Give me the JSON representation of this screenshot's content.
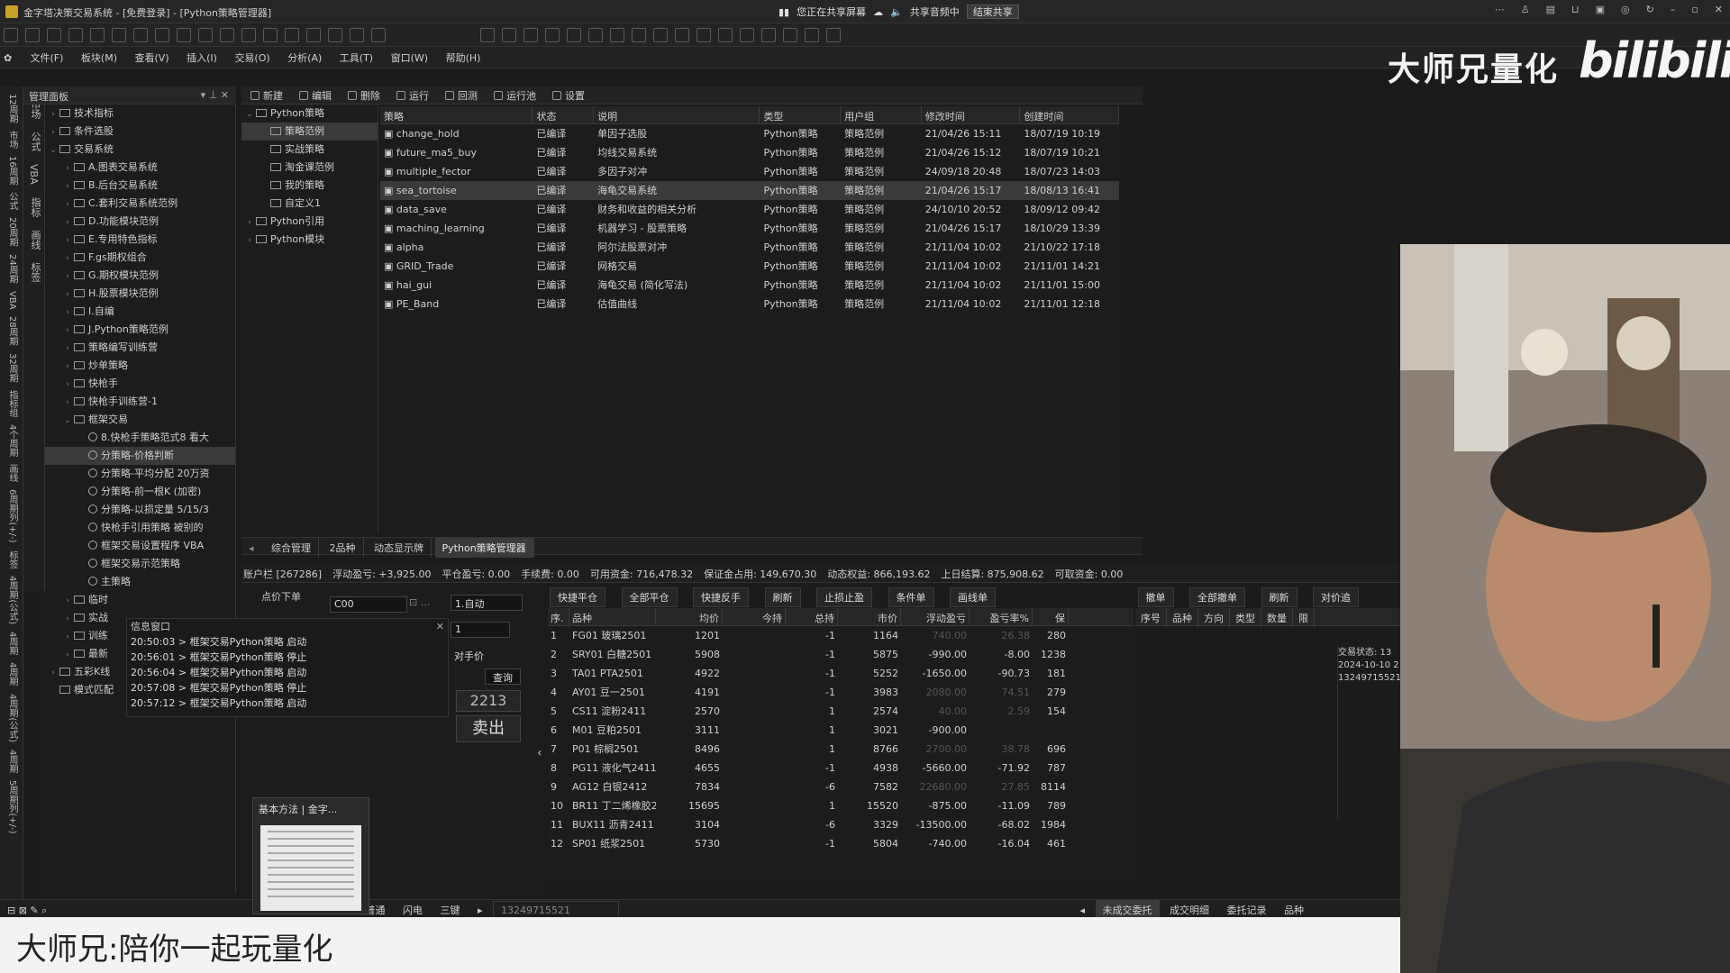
{
  "window": {
    "title": "金字塔决策交易系统 - [免费登录] - [Python策略管理器]",
    "share_status": "您正在共享屏幕",
    "share_audio": "共享音频中",
    "end_share": "结束共享"
  },
  "menu": [
    "文件(F)",
    "板块(M)",
    "查看(V)",
    "插入(I)",
    "交易(O)",
    "分析(A)",
    "工具(T)",
    "窗口(W)",
    "帮助(H)"
  ],
  "brand": {
    "name": "大师兄量化",
    "logo": "bilibili"
  },
  "left_tabs": [
    "12周期",
    "市场",
    "16周期",
    "公式",
    "20周期",
    "24周期",
    "VBA",
    "28周期",
    "32周期",
    "指标组",
    "4个周期",
    "画线",
    "6周期列(+/-)",
    "标签",
    "4周期(公式)",
    "4周期",
    "4周期",
    "4周期(公式)",
    "4周期",
    "5周期列(+/-)"
  ],
  "left_tabs2": [
    "市场",
    "公式",
    "VBA",
    "指标",
    "画线",
    "标签"
  ],
  "panel": {
    "title": "管理面板"
  },
  "tree1": [
    {
      "label": "技术指标",
      "exp": "›",
      "lvl": 0
    },
    {
      "label": "条件选股",
      "exp": "›",
      "lvl": 0
    },
    {
      "label": "交易系统",
      "exp": "⌄",
      "lvl": 0
    },
    {
      "label": "A.图表交易系统",
      "exp": "›",
      "lvl": 1
    },
    {
      "label": "B.后台交易系统",
      "exp": "›",
      "lvl": 1
    },
    {
      "label": "C.套利交易系统范例",
      "exp": "›",
      "lvl": 1
    },
    {
      "label": "D.功能模块范例",
      "exp": "›",
      "lvl": 1
    },
    {
      "label": "E.专用特色指标",
      "exp": "›",
      "lvl": 1
    },
    {
      "label": "F.gs期权组合",
      "exp": "›",
      "lvl": 1
    },
    {
      "label": "G.期权模块范例",
      "exp": "›",
      "lvl": 1
    },
    {
      "label": "H.股票模块范例",
      "exp": "›",
      "lvl": 1
    },
    {
      "label": "I.自编",
      "exp": "›",
      "lvl": 1
    },
    {
      "label": "J.Python策略范例",
      "exp": "›",
      "lvl": 1
    },
    {
      "label": "策略编写训练营",
      "exp": "›",
      "lvl": 1
    },
    {
      "label": "炒单策略",
      "exp": "›",
      "lvl": 1
    },
    {
      "label": "快枪手",
      "exp": "›",
      "lvl": 1
    },
    {
      "label": "快枪手训练营-1",
      "exp": "›",
      "lvl": 1
    },
    {
      "label": "框架交易",
      "exp": "⌄",
      "lvl": 1
    },
    {
      "label": "8.快枪手策略范式8 看大",
      "exp": "",
      "lvl": 2,
      "gear": true
    },
    {
      "label": "分策略-价格判断",
      "exp": "",
      "lvl": 2,
      "gear": true,
      "sel": true
    },
    {
      "label": "分策略-平均分配 20万资",
      "exp": "",
      "lvl": 2,
      "gear": true
    },
    {
      "label": "分策略-前一根K (加密)",
      "exp": "",
      "lvl": 2,
      "gear": true
    },
    {
      "label": "分策略-以损定量 5/15/3",
      "exp": "",
      "lvl": 2,
      "gear": true
    },
    {
      "label": "快枪手引用策略 被别的",
      "exp": "",
      "lvl": 2,
      "gear": true
    },
    {
      "label": "框架交易设置程序 VBA",
      "exp": "",
      "lvl": 2,
      "gear": true
    },
    {
      "label": "框架交易示范策略",
      "exp": "",
      "lvl": 2,
      "gear": true
    },
    {
      "label": "主策略",
      "exp": "",
      "lvl": 2,
      "gear": true
    },
    {
      "label": "临时",
      "exp": "›",
      "lvl": 1
    },
    {
      "label": "实战",
      "exp": "›",
      "lvl": 1
    },
    {
      "label": "训练",
      "exp": "›",
      "lvl": 1
    },
    {
      "label": "最新",
      "exp": "›",
      "lvl": 1
    },
    {
      "label": "五彩K线",
      "exp": "›",
      "lvl": 0
    },
    {
      "label": "模式匹配",
      "exp": "",
      "lvl": 0
    }
  ],
  "toolbar2": [
    "新建",
    "编辑",
    "删除",
    "运行",
    "回测",
    "运行池",
    "设置"
  ],
  "tree2": [
    {
      "label": "Python策略",
      "exp": "⌄",
      "lvl": 0
    },
    {
      "label": "策略范例",
      "exp": "",
      "lvl": 1,
      "sel": true
    },
    {
      "label": "实战策略",
      "exp": "",
      "lvl": 1
    },
    {
      "label": "淘金课范例",
      "exp": "",
      "lvl": 1
    },
    {
      "label": "我的策略",
      "exp": "",
      "lvl": 1
    },
    {
      "label": "自定义1",
      "exp": "",
      "lvl": 1
    },
    {
      "label": "Python引用",
      "exp": "›",
      "lvl": 0
    },
    {
      "label": "Python模块",
      "exp": "›",
      "lvl": 0
    }
  ],
  "strategy_table": {
    "headers": [
      "策略",
      "状态",
      "说明",
      "类型",
      "用户组",
      "修改时间",
      "创建时间"
    ],
    "rows": [
      [
        "change_hold",
        "已编译",
        "单因子选股",
        "Python策略",
        "策略范例",
        "21/04/26 15:11",
        "18/07/19 10:19"
      ],
      [
        "future_ma5_buy",
        "已编译",
        "均线交易系统",
        "Python策略",
        "策略范例",
        "21/04/26 15:12",
        "18/07/19 10:21"
      ],
      [
        "multiple_fector",
        "已编译",
        "多因子对冲",
        "Python策略",
        "策略范例",
        "24/09/18 20:48",
        "18/07/23 14:03"
      ],
      [
        "sea_tortoise",
        "已编译",
        "海龟交易系统",
        "Python策略",
        "策略范例",
        "21/04/26 15:17",
        "18/08/13 16:41"
      ],
      [
        "data_save",
        "已编译",
        "财务和收益的相关分析",
        "Python策略",
        "策略范例",
        "24/10/10 20:52",
        "18/09/12 09:42"
      ],
      [
        "maching_learning",
        "已编译",
        "机器学习 - 股票策略",
        "Python策略",
        "策略范例",
        "21/04/26 15:17",
        "18/10/29 13:39"
      ],
      [
        "alpha",
        "已编译",
        "阿尔法股票对冲",
        "Python策略",
        "策略范例",
        "21/11/04 10:02",
        "21/10/22 17:18"
      ],
      [
        "GRID_Trade",
        "已编译",
        "网格交易",
        "Python策略",
        "策略范例",
        "21/11/04 10:02",
        "21/11/01 14:21"
      ],
      [
        "hai_gui",
        "已编译",
        "海龟交易 (简化写法)",
        "Python策略",
        "策略范例",
        "21/11/04 10:02",
        "21/11/01 15:00"
      ],
      [
        "PE_Band",
        "已编译",
        "估值曲线",
        "Python策略",
        "策略范例",
        "21/11/04 10:02",
        "21/11/01 12:18"
      ]
    ]
  },
  "mid_tabs": [
    "综合管理",
    "2品种",
    "动态显示牌",
    "Python策略管理器"
  ],
  "account": [
    "账户栏 [267286]",
    "浮动盈亏: +3,925.00",
    "平仓盈亏: 0.00",
    "手续费: 0.00",
    "可用资金: 716,478.32",
    "保证金占用: 149,670.30",
    "动态权益: 866,193.62",
    "上日结算: 875,908.62",
    "可取资金: 0.00"
  ],
  "order": {
    "label": "点价下单",
    "code": "C00",
    "mode": "1.自动",
    "qty": "1",
    "price_type": "对手价",
    "query": "查询",
    "price": "2213",
    "sell": "卖出"
  },
  "log": {
    "title": "信息窗口",
    "lines": [
      "20:50:03 > 框架交易Python策略 启动",
      "20:56:01 > 框架交易Python策略 停止",
      "20:56:04 > 框架交易Python策略 启动",
      "20:57:08 > 框架交易Python策略 停止",
      "20:57:12 > 框架交易Python策略 启动"
    ]
  },
  "pos_buttons": [
    "快捷平仓",
    "全部平仓",
    "快捷反手",
    "刷新",
    "止损止盈",
    "条件单",
    "画线单"
  ],
  "right_buttons": [
    "撤单",
    "全部撤单",
    "刷新",
    "对价追"
  ],
  "pos_table": {
    "headers": [
      "序.",
      "品种",
      "均价",
      "今持",
      "总持",
      "市价",
      "浮动盈亏",
      "盈亏率%",
      "保"
    ],
    "rows": [
      [
        "1",
        "FG01 玻璃2501",
        "1201",
        "",
        "-1",
        "1164",
        "740.00",
        "26.38",
        "280"
      ],
      [
        "2",
        "SRY01 白糖2501",
        "5908",
        "",
        "-1",
        "5875",
        "-990.00",
        "-8.00",
        "1238"
      ],
      [
        "3",
        "TA01 PTA2501",
        "4922",
        "",
        "-1",
        "5252",
        "-1650.00",
        "-90.73",
        "181"
      ],
      [
        "4",
        "AY01 豆一2501",
        "4191",
        "",
        "-1",
        "3983",
        "2080.00",
        "74.51",
        "279"
      ],
      [
        "5",
        "CS11 淀粉2411",
        "2570",
        "",
        "1",
        "2574",
        "40.00",
        "2.59",
        "154"
      ],
      [
        "6",
        "M01 豆粕2501",
        "3111",
        "",
        "1",
        "3021",
        "-900.00",
        "",
        ""
      ],
      [
        "7",
        "P01 棕榈2501",
        "8496",
        "",
        "1",
        "8766",
        "2700.00",
        "38.78",
        "696"
      ],
      [
        "8",
        "PG11 液化气2411",
        "4655",
        "",
        "-1",
        "4938",
        "-5660.00",
        "-71.92",
        "787"
      ],
      [
        "9",
        "AG12 白银2412",
        "7834",
        "",
        "-6",
        "7582",
        "22680.00",
        "27.85",
        "8114"
      ],
      [
        "10",
        "BR11 丁二烯橡胶2411",
        "15695",
        "",
        "1",
        "15520",
        "-875.00",
        "-11.09",
        "789"
      ],
      [
        "11",
        "BUX11 沥青2411",
        "3104",
        "",
        "-6",
        "3329",
        "-13500.00",
        "-68.02",
        "1984"
      ],
      [
        "12",
        "SP01 纸浆2501",
        "5730",
        "",
        "-1",
        "5804",
        "-740.00",
        "-16.04",
        "461"
      ]
    ]
  },
  "order_table_headers": [
    "序号",
    "品种",
    "方向",
    "类型",
    "数量",
    "限"
  ],
  "status": {
    "label": "交易状态: 13",
    "date": "2024-10-10 2",
    "acct": "13249715521"
  },
  "bottom": {
    "tabs": [
      "普通",
      "闪电",
      "三键"
    ],
    "account_no": "13249715521",
    "right_tabs": [
      "未成交委托",
      "成交明细",
      "委托记录",
      "品种"
    ]
  },
  "thumb": {
    "title": "基本方法 | 金字..."
  },
  "caption": "大师兄:陪你一起玩量化"
}
